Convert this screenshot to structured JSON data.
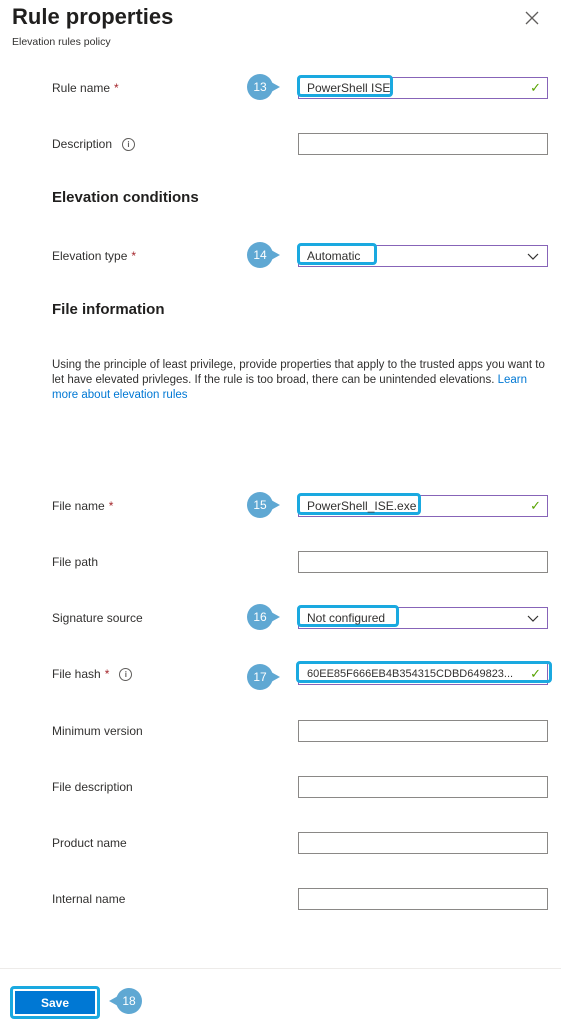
{
  "header": {
    "title": "Rule properties",
    "subtitle": "Elevation rules policy",
    "close_icon": "close-icon"
  },
  "fields": {
    "rule_name": {
      "label": "Rule name",
      "value": "PowerShell ISE",
      "required": "*"
    },
    "description": {
      "label": "Description",
      "value": ""
    },
    "elevation_type": {
      "label": "Elevation type",
      "value": "Automatic",
      "required": "*"
    },
    "file_name": {
      "label": "File name",
      "value": "PowerShell_ISE.exe",
      "required": "*"
    },
    "file_path": {
      "label": "File path",
      "value": ""
    },
    "signature_source": {
      "label": "Signature source",
      "value": "Not configured"
    },
    "file_hash": {
      "label": "File hash",
      "value": "60EE85F666EB4B354315CDBD649823...",
      "required": "*"
    },
    "minimum_version": {
      "label": "Minimum version",
      "value": ""
    },
    "file_description": {
      "label": "File description",
      "value": ""
    },
    "product_name": {
      "label": "Product name",
      "value": ""
    },
    "internal_name": {
      "label": "Internal name",
      "value": ""
    }
  },
  "sections": {
    "elevation_conditions": "Elevation conditions",
    "file_information": "File information"
  },
  "info_text": {
    "body": "Using the principle of least privilege, provide properties that apply to the trusted apps you want to let have elevated privleges. If the rule is too broad, there can be unintended elevations. ",
    "link": "Learn more about elevation rules"
  },
  "callouts": [
    "13",
    "14",
    "15",
    "16",
    "17",
    "18"
  ],
  "footer": {
    "save_label": "Save"
  },
  "colors": {
    "accent": "#0078d4",
    "highlight": "#1aa9e0",
    "callout": "#5fa8d3",
    "valid_check": "#57a300",
    "required": "#a4262c"
  }
}
